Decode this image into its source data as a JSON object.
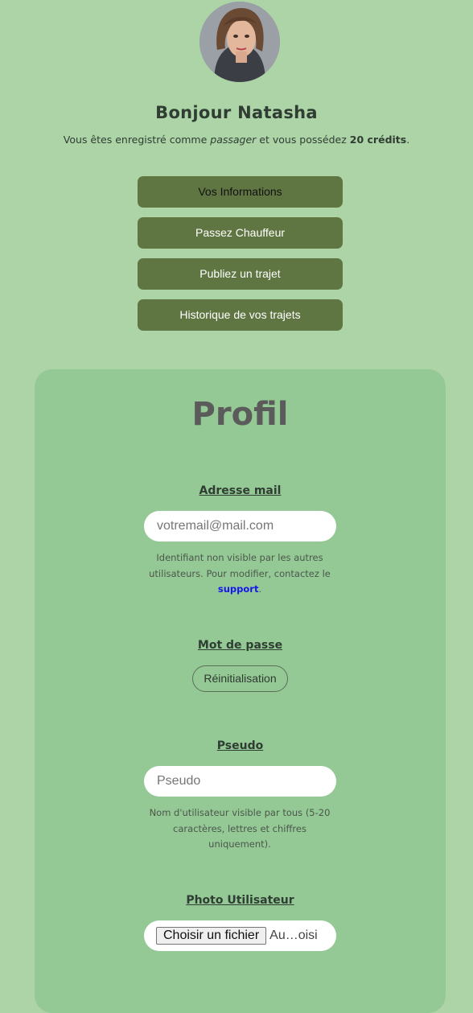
{
  "header": {
    "greeting": "Bonjour Natasha",
    "status_prefix": "Vous êtes enregistré comme ",
    "status_role": "passager",
    "status_middle": " et vous possédez ",
    "status_credits": "20 crédits",
    "status_suffix": "."
  },
  "menu": {
    "info_label": "Vos Informations",
    "driver_label": "Passez Chauffeur",
    "publish_label": "Publiez un trajet",
    "history_label": "Historique de vos trajets"
  },
  "profile": {
    "title": "Profil",
    "email": {
      "label": "Adresse mail",
      "placeholder": "votremail@mail.com",
      "help_before": "Identifiant non visible par les autres utilisateurs. Pour modifier, contactez le ",
      "help_link": "support",
      "help_after": "."
    },
    "password": {
      "label": "Mot de passe",
      "reset_label": "Réinitialisation"
    },
    "pseudo": {
      "label": "Pseudo",
      "placeholder": "Pseudo",
      "help": "Nom d'utilisateur visible par tous (5-20 caractères, lettres et chiffres uniquement)."
    },
    "photo": {
      "label": "Photo Utilisateur",
      "button_label": "Choisir un fichier",
      "status": "Au…oisi"
    }
  },
  "colors": {
    "page_bg": "#acd4a6",
    "card_bg": "#94c995",
    "button_bg": "#607642",
    "link": "#1515ee"
  },
  "icons": {
    "avatar": "user-avatar-photo"
  }
}
